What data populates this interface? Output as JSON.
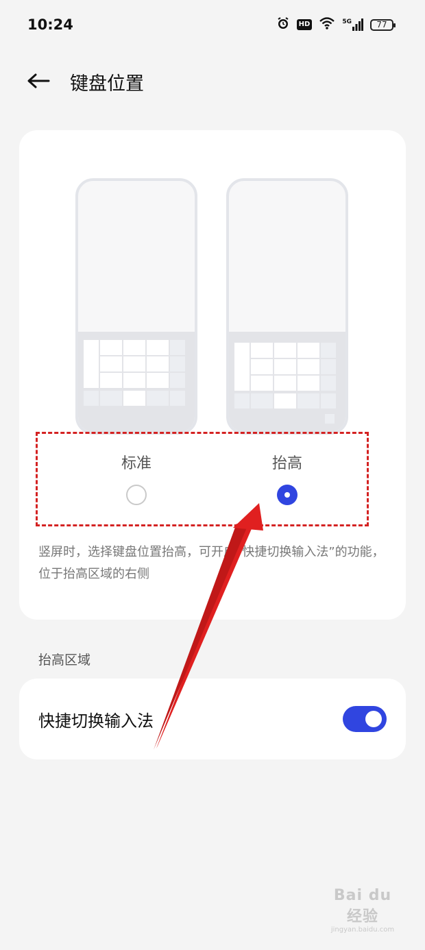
{
  "status_bar": {
    "time": "10:24",
    "hd": "HD",
    "network": "5G",
    "battery": "77"
  },
  "header": {
    "title": "键盘位置"
  },
  "options": [
    {
      "label": "标准",
      "selected": false
    },
    {
      "label": "抬高",
      "selected": true
    }
  ],
  "description": "竖屏时，选择键盘位置抬高，可开启“快捷切换输入法”的功能，位于抬高区域的右侧",
  "section": {
    "title": "抬高区域"
  },
  "toggle": {
    "label": "快捷切换输入法",
    "on": true
  },
  "colors": {
    "accent": "#3045e0",
    "annotation": "#d42222"
  },
  "watermark": {
    "main": "Bai du 经验",
    "sub": "jingyan.baidu.com"
  }
}
